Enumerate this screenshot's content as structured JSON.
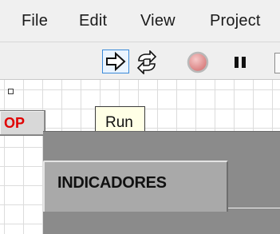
{
  "menu": {
    "file": "File",
    "edit": "Edit",
    "view": "View",
    "project": "Project"
  },
  "toolbar": {
    "run_icon": "run-arrow-icon",
    "continuous_run_icon": "continuous-run-icon",
    "abort_icon": "abort-icon",
    "pause_icon": "pause-icon"
  },
  "front_panel": {
    "stop_button_label": "OP",
    "tooltip": "Run",
    "tab_label": "INDICADORES"
  },
  "colors": {
    "stop_text": "#e00000",
    "tooltip_bg": "#ffffe6",
    "run_highlight": "#3b8ad9"
  }
}
